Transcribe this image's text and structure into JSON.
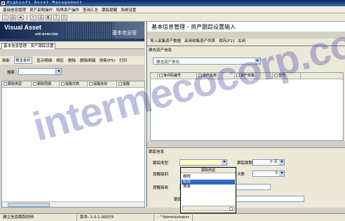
{
  "window": {
    "title": "Highsoft Asset Management"
  },
  "menu": [
    "基础信息管理",
    "资产采购操作",
    "特殊资产操作",
    "查询汇总",
    "跟踪提醒",
    "系统设置"
  ],
  "banner": {
    "title": "Visual Asset",
    "subtitle": "with BARCODE",
    "right_text": "基本信息管"
  },
  "left": {
    "tab": "基本信息管理 - 资产跟踪设置",
    "toolbar": [
      "刷新",
      "预览条件",
      "显示明细",
      "排区",
      "删除",
      "删除明细",
      "刷新(F5)",
      "打印"
    ],
    "active_tool": "预览条件",
    "search_label": "搜索",
    "columns": [
      "跟踪类型",
      "跟踪周期",
      "提醒次数",
      "提醒级别",
      "提醒"
    ]
  },
  "right": {
    "title": "基本信息管理 - 资产跟踪设置输入",
    "toolbar": [
      "导入采集资产数据",
      "采用收集资产列表",
      "保存[F2]",
      "关闭"
    ],
    "static_group": "静态资产信息",
    "asset_placeholder": "静态资产条码",
    "columns": [
      "条件码编号",
      "资产名称",
      "资产规格",
      "型号"
    ],
    "track_group": "跟踪信息",
    "fields": {
      "track_type_label": "跟踪类型",
      "track_cycle_label": "跟踪周期",
      "track_cycle_value": "0",
      "track_cycle_unit": "天",
      "remind_level_label": "提醒级别",
      "remind_times_label": "次数",
      "remind_times_value": "0",
      "remind_person_label": "提醒接收",
      "track_note_label": "跟踪备注"
    }
  },
  "dropdown": {
    "header": "跟踪类型",
    "options": [
      "维修",
      "检查",
      "报废"
    ],
    "selected_index": 1
  },
  "status": [
    "建立信息跟踪的档",
    "版本: 1.0.1.00079",
    "- ^Administrator"
  ],
  "watermark": "intermecocorp.com"
}
